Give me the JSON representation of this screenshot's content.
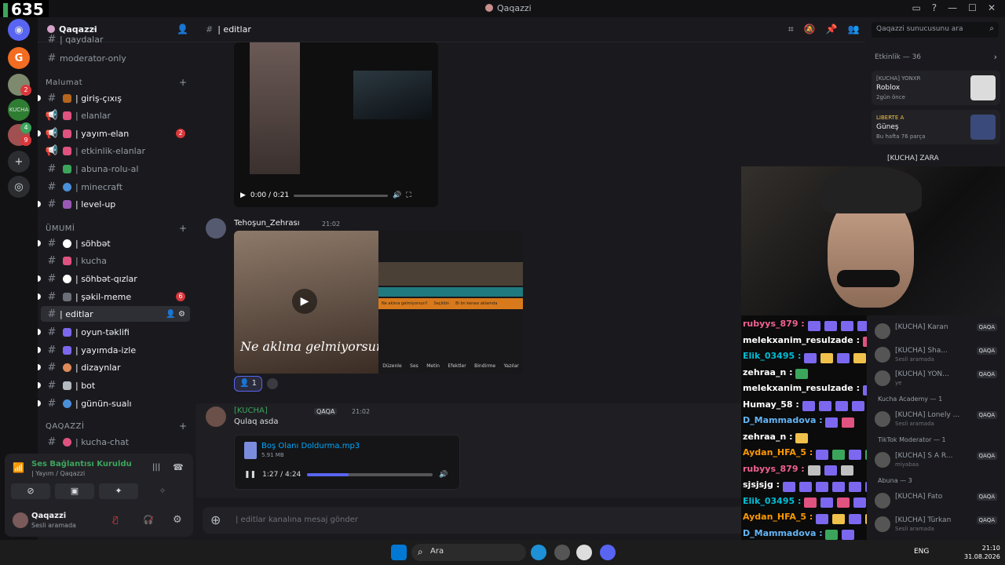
{
  "overlay": {
    "viewer_count": "635"
  },
  "window": {
    "title": "Qaqazzi"
  },
  "colors": {
    "accent": "#5865f2",
    "green": "#3ba55c",
    "red": "#da373c",
    "background": "#1a1a1e"
  },
  "guilds": {
    "badges": [
      "2",
      "4",
      "9"
    ]
  },
  "server": {
    "name": "Qaqazzi",
    "chevron": "chevron-down-icon",
    "partial_top": "| qaydalar",
    "channels_top": [
      {
        "name": "moderator-only"
      }
    ],
    "categories": [
      {
        "title": "Malumat",
        "channels": [
          {
            "name": "| giriş-çıxış",
            "unread": true
          },
          {
            "name": "| elanlar",
            "icon": "megaphone-icon"
          },
          {
            "name": "| yayım-elan",
            "unread": true,
            "badge": "2",
            "icon": "megaphone-icon"
          },
          {
            "name": "| etkinlik-elanlar",
            "icon": "megaphone-icon"
          },
          {
            "name": "| abuna-rolu-al"
          },
          {
            "name": "| minecraft"
          },
          {
            "name": "| level-up",
            "unread": true
          }
        ]
      },
      {
        "title": "ÜMUMİ",
        "channels": [
          {
            "name": "| söhbət",
            "unread": true
          },
          {
            "name": "| kucha"
          },
          {
            "name": "| söhbət-qızlar",
            "unread": true
          },
          {
            "name": "| şəkil-meme",
            "unread": true,
            "badge": "6"
          },
          {
            "name": "| editlar",
            "active": true
          },
          {
            "name": "| oyun-təklifi",
            "unread": true
          },
          {
            "name": "| yayımda-izle",
            "unread": true
          },
          {
            "name": "| dizaynlar",
            "unread": true
          },
          {
            "name": "| bot",
            "unread": true
          },
          {
            "name": "| günün-sualı",
            "unread": true
          }
        ]
      },
      {
        "title": "QAQAZZİ",
        "channels": [
          {
            "name": "| kucha-chat"
          }
        ]
      }
    ]
  },
  "voice": {
    "status": "Ses Bağlantısı Kuruldu",
    "channel": "| Yayım / Qaqazzi",
    "user_name": "Qaqazzi",
    "user_status": "Sesli aramada"
  },
  "chat": {
    "channel_title": "| editlar",
    "search_placeholder": "Qaqazzi sunucusunu ara",
    "composer_placeholder": "| editlar kanalına mesaj gönder",
    "video1": {
      "time": "0:00 / 0:21",
      "progress": 0.0
    },
    "message2": {
      "author": "Tehoşun_Zehrası",
      "time": "21:02",
      "caption": "Ne aklına gelmiyorsun?",
      "reaction_count": "1",
      "tools": [
        "Düzenle",
        "Ses",
        "Metin",
        "Efektler",
        "Bindirme",
        "Yazılar"
      ],
      "clips": [
        "Ne aklına gelmiyorsun?",
        "Seçildin",
        "Bi ön kenası aklamda"
      ]
    },
    "message3": {
      "author": "[KUCHA]",
      "tag": "QAQA",
      "time": "21:02",
      "text": "Qulaq asda",
      "attachment": {
        "file_name": "Boş Olanı Doldurma.mp3",
        "file_size": "5.91 MB",
        "time": "1:27 / 4:24",
        "progress": 0.33
      }
    }
  },
  "activity": {
    "header": "Etkinlik — 36",
    "cards": [
      {
        "line1": "[KUCHA] YONXR",
        "line2": "Roblox",
        "line3": "2gün önce"
      },
      {
        "line1": "LIBERTE A",
        "line2": "Güneş",
        "line3": "Bu hafta 76 parça"
      }
    ],
    "partial": "[KUCHA] ZARA"
  },
  "stream_chat": [
    {
      "user": "rubyys_879",
      "color": "#f06292",
      "emotes": 5
    },
    {
      "user": "melekxanim_resulzade",
      "color": "#ffffff",
      "emotes": 1
    },
    {
      "user": "Elik_03495",
      "color": "#00bcd4",
      "emotes": 6
    },
    {
      "user": "zehraa_n",
      "color": "#ffffff",
      "emotes": 1
    },
    {
      "user": "melekxanim_resulzade",
      "color": "#ffffff",
      "emotes": 1
    },
    {
      "user": "Humay_58",
      "color": "#ffffff",
      "emotes": 6
    },
    {
      "user": "D_Mammadova",
      "color": "#64b5f6",
      "emotes": 2
    },
    {
      "user": "zehraa_n",
      "color": "#ffffff",
      "emotes": 1
    },
    {
      "user": "Aydan_HFA_5",
      "color": "#ff9800",
      "emotes": 4
    },
    {
      "user": "rubyys_879",
      "color": "#f06292",
      "emotes": 3
    },
    {
      "user": "sjsjsjg",
      "color": "#ffffff",
      "emotes": 6
    },
    {
      "user": "Elik_03495",
      "color": "#00bcd4",
      "emotes": 6
    },
    {
      "user": "Aydan_HFA_5",
      "color": "#ff9800",
      "emotes": 5
    },
    {
      "user": "D_Mammadova",
      "color": "#64b5f6",
      "emotes": 2
    },
    {
      "user": "rubyys_879",
      "color": "#f06292",
      "emotes": 5
    }
  ],
  "members": [
    {
      "name": "[KUCHA] Karan",
      "status": "",
      "tag": "QAQA"
    },
    {
      "name": "[KUCHA] Sha...",
      "status": "Sesli aramada",
      "tag": "QAQA"
    },
    {
      "name": "[KUCHA] YON...",
      "status": "ye",
      "tag": "QAQA"
    },
    {
      "group": "Kucha Academy — 1"
    },
    {
      "name": "[KUCHA] Lonely ...",
      "status": "Sesli aramada",
      "tag": "QAQA"
    },
    {
      "group": "TikTok Moderator — 1"
    },
    {
      "name": "[KUCHA] S A R...",
      "status": "miyabaa",
      "tag": "QAQA"
    },
    {
      "group": "Abuna — 3"
    },
    {
      "name": "[KUCHA] Fato",
      "status": "",
      "tag": "QAQA"
    },
    {
      "name": "[KUCHA] Türkan",
      "status": "Sesli aramada",
      "tag": "QAQA"
    }
  ],
  "taskbar": {
    "search_label": "Ara",
    "language": "ENG",
    "time": "21:10",
    "date": "31.08.2026"
  }
}
